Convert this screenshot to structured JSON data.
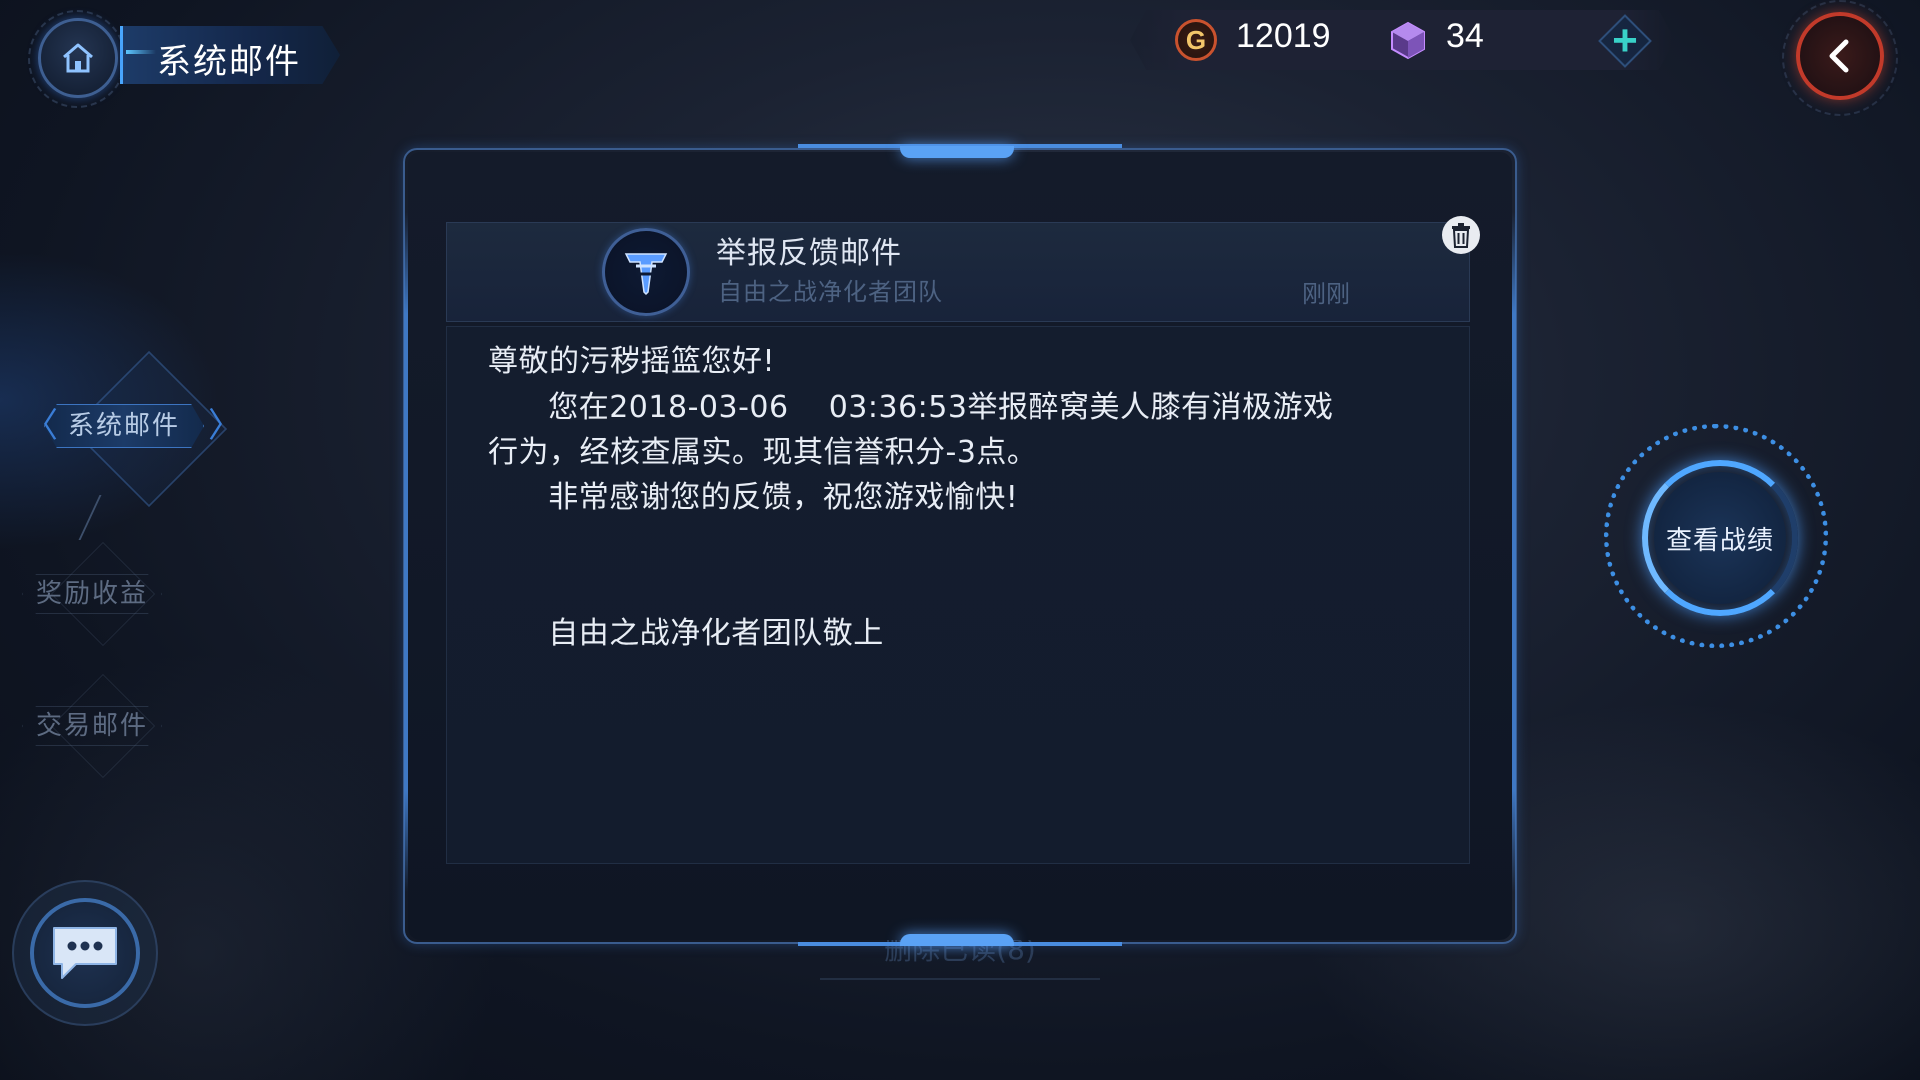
{
  "header": {
    "title": "系统邮件"
  },
  "currency": {
    "gold_symbol": "G",
    "gold": "12019",
    "gems": "34",
    "add_label": "+"
  },
  "nav": {
    "active": "系统邮件",
    "items": [
      {
        "label": "奖励收益"
      },
      {
        "label": "交易邮件"
      }
    ],
    "chev_left": "〈",
    "chev_right": "〉"
  },
  "mail": {
    "title": "举报反馈邮件",
    "sender": "自由之战净化者团队",
    "time": "刚刚",
    "body": [
      "尊敬的污秽摇篮您好!",
      "      您在2018-03-06    03:36:53举报醉窝美人膝有消极游戏",
      "行为，经核查属实。现其信誉积分-3点。",
      "      非常感谢您的反馈，祝您游戏愉快!",
      "      自由之战净化者团队敬上"
    ]
  },
  "footer": {
    "delete_read": "删除已读(8)"
  },
  "side": {
    "view_stats": "查看战绩"
  },
  "colors": {
    "accent": "#4a8de0",
    "danger": "#c23a2a",
    "gold": "#c9522e",
    "teal": "#39d2c9"
  }
}
